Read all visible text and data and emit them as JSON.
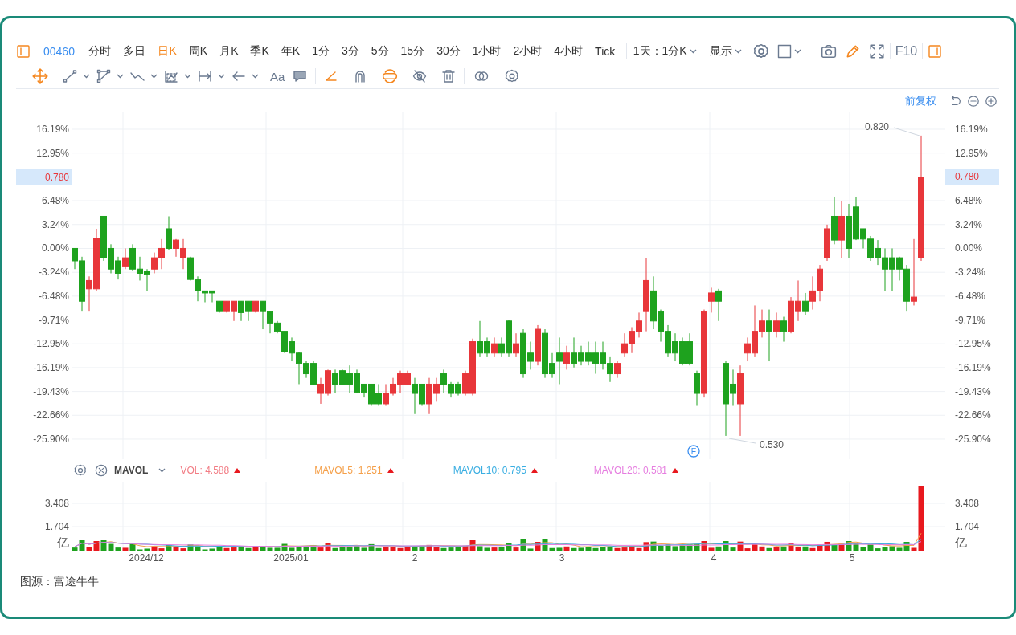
{
  "toolbar": {
    "symbol": "00460",
    "periods": [
      {
        "label": "分时",
        "selected": false
      },
      {
        "label": "多日",
        "selected": false
      },
      {
        "label": "日K",
        "selected": true
      },
      {
        "label": "周K",
        "selected": false
      },
      {
        "label": "月K",
        "selected": false
      },
      {
        "label": "季K",
        "selected": false
      },
      {
        "label": "年K",
        "selected": false
      },
      {
        "label": "1分",
        "selected": false
      },
      {
        "label": "3分",
        "selected": false
      },
      {
        "label": "5分",
        "selected": false
      },
      {
        "label": "15分",
        "selected": false
      },
      {
        "label": "30分",
        "selected": false
      },
      {
        "label": "1小时",
        "selected": false
      },
      {
        "label": "2小时",
        "selected": false
      },
      {
        "label": "4小时",
        "selected": false
      },
      {
        "label": "Tick",
        "selected": false
      }
    ],
    "range": "1天：1分K",
    "display": "显示",
    "f10": "F10"
  },
  "drawing_tools": {
    "text_tool": "Aa"
  },
  "chart": {
    "adjustment": "前复权",
    "current_price": "0.780",
    "right_axis": [
      {
        "text": "16.19%",
        "highlighted": false
      },
      {
        "text": "12.95%",
        "highlighted": false
      },
      {
        "text": "0.780",
        "highlighted": true
      },
      {
        "text": "6.48%",
        "highlighted": false
      },
      {
        "text": "3.24%",
        "highlighted": false
      },
      {
        "text": "0.00%",
        "highlighted": false
      },
      {
        "text": "-3.24%",
        "highlighted": false
      },
      {
        "text": "-6.48%",
        "highlighted": false
      },
      {
        "text": "-9.71%",
        "highlighted": false
      },
      {
        "text": "-12.95%",
        "highlighted": false
      },
      {
        "text": "-16.19%",
        "highlighted": false
      },
      {
        "text": "-19.43%",
        "highlighted": false
      },
      {
        "text": "-22.66%",
        "highlighted": false
      },
      {
        "text": "-25.90%",
        "highlighted": false
      }
    ],
    "high_label": "0.820",
    "low_label": "0.530",
    "event_marker": "E",
    "chart_data": {
      "type": "candlestick",
      "ylim": [
        -28.63,
        18.48
      ],
      "grid": true,
      "ref_lines": [
        {
          "axis": "y",
          "value": 9.7
        }
      ],
      "yticks": [
        {
          "value": 16.19,
          "label": "16.19%"
        },
        {
          "value": 12.95,
          "label": "12.95%"
        },
        {
          "value": 6.48,
          "label": "6.48%"
        },
        {
          "value": 3.24,
          "label": "3.24%"
        },
        {
          "value": 0,
          "label": "0.00%"
        },
        {
          "value": -3.24,
          "label": "-3.24%"
        },
        {
          "value": -6.48,
          "label": "-6.48%"
        },
        {
          "value": -9.71,
          "label": "-9.71%"
        },
        {
          "value": -12.95,
          "label": "-12.95%"
        },
        {
          "value": -16.19,
          "label": "-16.19%"
        },
        {
          "value": -19.43,
          "label": "-19.43%"
        },
        {
          "value": -22.66,
          "label": "-22.66%"
        },
        {
          "value": -25.9,
          "label": "-25.90%"
        }
      ],
      "categories": [
        null,
        null,
        null,
        null,
        null,
        null,
        null,
        null,
        null,
        null,
        null,
        null,
        null,
        null,
        null,
        null,
        null,
        null,
        null,
        null,
        null,
        null,
        null,
        null,
        null,
        null,
        null,
        null,
        null,
        null,
        null,
        null,
        null,
        null,
        null,
        null,
        null,
        null,
        null,
        null,
        null,
        null,
        null,
        null,
        null,
        null,
        null,
        null,
        null,
        null,
        null,
        null,
        null,
        null,
        null,
        null,
        null,
        null,
        null,
        null,
        null,
        null,
        null,
        null,
        null,
        null,
        null,
        null,
        null,
        null,
        null,
        null,
        null,
        null,
        null,
        null,
        null,
        null,
        null,
        null,
        null,
        null,
        null,
        null,
        null,
        null,
        null,
        null,
        null,
        null,
        null,
        null,
        null,
        null,
        null,
        null,
        null,
        null,
        null,
        null,
        null,
        null,
        null,
        null,
        null,
        null,
        null,
        null,
        null,
        null,
        null,
        null,
        null,
        null,
        null,
        null,
        null,
        null
      ],
      "ohlc": [
        [
          0,
          0,
          -2.81,
          -1.69
        ],
        [
          -1.69,
          -1.13,
          -8.58,
          -7.17
        ],
        [
          -5.49,
          -3.8,
          -8.58,
          -4.36
        ],
        [
          -5.49,
          2.67,
          -5.77,
          1.41
        ],
        [
          4.36,
          4.36,
          -1.69,
          -1.27
        ],
        [
          0,
          0.56,
          -3.38,
          -2.81
        ],
        [
          -1.69,
          -1.13,
          -4.22,
          -3.38
        ],
        [
          -2.39,
          0,
          -2.81,
          -1.27
        ],
        [
          0,
          0.56,
          -3.09,
          -2.81
        ],
        [
          -2.81,
          -1.13,
          -4.36,
          -3.38
        ],
        [
          -3.09,
          -2.81,
          -5.77,
          -3.52
        ],
        [
          -2.81,
          -0.56,
          -3.38,
          -1.27
        ],
        [
          -1.27,
          1.27,
          -2.81,
          0
        ],
        [
          2.67,
          4.36,
          -0.28,
          0
        ],
        [
          0,
          1.27,
          -1.13,
          1.13
        ],
        [
          -1.27,
          1.27,
          -2.81,
          0
        ],
        [
          -1.27,
          -1.13,
          -4.36,
          -4.22
        ],
        [
          -4.22,
          -3.8,
          -7.17,
          -5.77
        ],
        [
          -5.77,
          -5.77,
          -7.31,
          -6.05
        ],
        [
          -5.77,
          -5.77,
          -7.31,
          -6.05
        ],
        [
          -7.17,
          -7.17,
          -8.72,
          -8.58
        ],
        [
          -8.58,
          -7.17,
          -8.72,
          -7.17
        ],
        [
          -8.58,
          -7.17,
          -9.85,
          -7.17
        ],
        [
          -7.17,
          -7.17,
          -9.85,
          -8.72
        ],
        [
          -7.17,
          -7.17,
          -9.85,
          -8.58
        ],
        [
          -8.58,
          -7.17,
          -8.72,
          -7.17
        ],
        [
          -7.17,
          -7.17,
          -10.97,
          -8.58
        ],
        [
          -8.58,
          -8.58,
          -11.53,
          -10.13
        ],
        [
          -10.13,
          -9.85,
          -11.53,
          -11.25
        ],
        [
          -11.25,
          -11.25,
          -14.21,
          -14.07
        ],
        [
          -12.66,
          -12.1,
          -15.33,
          -14.21
        ],
        [
          -14.21,
          -14.07,
          -18.43,
          -15.61
        ],
        [
          -15.61,
          -15.33,
          -17.58,
          -17.02
        ],
        [
          -15.61,
          -15.33,
          -18.57,
          -18.43
        ],
        [
          -19.69,
          -17.58,
          -21.1,
          -18.43
        ],
        [
          -19.69,
          -16.46,
          -19.97,
          -16.6
        ],
        [
          -17.02,
          -16.46,
          -19.69,
          -18.43
        ],
        [
          -16.6,
          -16.46,
          -18.57,
          -18.43
        ],
        [
          -17.02,
          -15.89,
          -19.69,
          -18.43
        ],
        [
          -17.02,
          -16.46,
          -19.69,
          -19.55
        ],
        [
          -18.43,
          -18.43,
          -20.25,
          -19.55
        ],
        [
          -18.43,
          -18.43,
          -21.38,
          -21.1
        ],
        [
          -19.69,
          -18.43,
          -21.38,
          -21.1
        ],
        [
          -21.1,
          -18.43,
          -21.38,
          -19.69
        ],
        [
          -19.69,
          -17.58,
          -19.97,
          -18.43
        ],
        [
          -18.43,
          -16.6,
          -19.69,
          -17.02
        ],
        [
          -18.43,
          -16.6,
          -18.57,
          -17.02
        ],
        [
          -18.43,
          -17.58,
          -22.5,
          -19.69
        ],
        [
          -18.43,
          -18.43,
          -21.38,
          -21.1
        ],
        [
          -21.1,
          -17.58,
          -22.5,
          -18.43
        ],
        [
          -19.69,
          -17.58,
          -20.82,
          -18.43
        ],
        [
          -17.02,
          -16.46,
          -19.69,
          -18.43
        ],
        [
          -18.43,
          -18.14,
          -20.25,
          -19.69
        ],
        [
          -18.43,
          -18.14,
          -19.97,
          -19.69
        ],
        [
          -19.69,
          -16.6,
          -19.97,
          -17.02
        ],
        [
          -19.69,
          -12.24,
          -19.97,
          -12.66
        ],
        [
          -12.66,
          -9.85,
          -14.77,
          -14.21
        ],
        [
          -12.66,
          -12.1,
          -14.77,
          -14.21
        ],
        [
          -14.21,
          -12.1,
          -14.77,
          -12.94
        ],
        [
          -12.94,
          -12.1,
          -14.77,
          -14.21
        ],
        [
          -9.85,
          -9.7,
          -14.77,
          -14.21
        ],
        [
          -14.21,
          -11.53,
          -14.77,
          -12.94
        ],
        [
          -11.53,
          -10.97,
          -17.58,
          -17.02
        ],
        [
          -14.21,
          -12.66,
          -16.46,
          -15.33
        ],
        [
          -15.33,
          -10.41,
          -15.89,
          -10.97
        ],
        [
          -11.53,
          -10.97,
          -17.58,
          -17.02
        ],
        [
          -15.61,
          -14.21,
          -17.58,
          -17.02
        ],
        [
          -14.21,
          -12.1,
          -18.43,
          -15.33
        ],
        [
          -15.61,
          -13.22,
          -16.46,
          -14.21
        ],
        [
          -14.21,
          -12.1,
          -16.17,
          -15.61
        ],
        [
          -14.21,
          -13.22,
          -15.89,
          -15.33
        ],
        [
          -14.21,
          -12.66,
          -15.89,
          -15.33
        ],
        [
          -14.21,
          -12.66,
          -17.02,
          -15.61
        ],
        [
          -14.21,
          -12.66,
          -16.46,
          -15.61
        ],
        [
          -15.61,
          -14.77,
          -18.14,
          -17.02
        ],
        [
          -17.02,
          -15.33,
          -17.58,
          -15.61
        ],
        [
          -14.21,
          -11.53,
          -14.77,
          -12.94
        ],
        [
          -12.94,
          -10.69,
          -14.21,
          -11.25
        ],
        [
          -11.25,
          -8.72,
          -12.1,
          -9.85
        ],
        [
          -8.58,
          -1.27,
          -11.25,
          -4.36
        ],
        [
          -5.77,
          -3.8,
          -10.97,
          -9.85
        ],
        [
          -8.58,
          -8.3,
          -12.66,
          -11.25
        ],
        [
          -11.25,
          -10.41,
          -14.77,
          -14.21
        ],
        [
          -12.66,
          -11.53,
          -15.33,
          -14.21
        ],
        [
          -12.66,
          -12.1,
          -15.89,
          -15.61
        ],
        [
          -12.66,
          -11.53,
          -15.89,
          -15.61
        ],
        [
          -17.02,
          -16.6,
          -21.38,
          -19.69
        ],
        [
          -19.69,
          -8.3,
          -20.25,
          -8.58
        ],
        [
          -7.17,
          -5.34,
          -8.72,
          -6.05
        ],
        [
          -5.77,
          -5.49,
          -9.85,
          -7.17
        ],
        [
          -15.61,
          -15.33,
          -25.46,
          -21.1
        ],
        [
          -18.43,
          -16.46,
          -21.38,
          -19.69
        ],
        [
          -21.1,
          -15.89,
          -25.46,
          -17.02
        ],
        [
          -14.21,
          -12.1,
          -15.33,
          -12.94
        ],
        [
          -14.21,
          -7.74,
          -14.77,
          -11.25
        ],
        [
          -11.25,
          -8.3,
          -12.1,
          -9.85
        ],
        [
          -9.85,
          -8.3,
          -15.33,
          -11.25
        ],
        [
          -11.25,
          -8.72,
          -12.1,
          -9.85
        ],
        [
          -9.85,
          -9.28,
          -12.66,
          -11.25
        ],
        [
          -11.25,
          -6.61,
          -11.53,
          -7.17
        ],
        [
          -8.58,
          -4.36,
          -9.85,
          -7.17
        ],
        [
          -7.17,
          -6.05,
          -9,
          -8.58
        ],
        [
          -7.17,
          -3.8,
          -8.3,
          -5.77
        ],
        [
          -5.77,
          -2.25,
          -7.17,
          -2.81
        ],
        [
          -1.27,
          3.23,
          -1.69,
          2.67
        ],
        [
          4.36,
          7.03,
          0.56,
          1.13
        ],
        [
          1.13,
          6.47,
          -1.27,
          4.36
        ],
        [
          4.36,
          6.05,
          -1.27,
          0
        ],
        [
          5.63,
          7.03,
          1.13,
          1.27
        ],
        [
          2.67,
          2.67,
          0,
          1.27
        ],
        [
          1.27,
          1.69,
          -1.69,
          -1.27
        ],
        [
          0,
          1.13,
          -2.25,
          -1.27
        ],
        [
          -1.27,
          0,
          -5.77,
          -2.81
        ],
        [
          -1.27,
          0,
          -5.77,
          -2.81
        ],
        [
          -1.27,
          -1.13,
          -4.36,
          -2.81
        ],
        [
          -2.81,
          -2.25,
          -8.58,
          -7.17
        ],
        [
          -7.17,
          1.27,
          -7.74,
          -6.61
        ],
        [
          -1.27,
          15.33,
          -1.69,
          9.7
        ]
      ]
    }
  },
  "volume": {
    "indicator": "MAVOL",
    "legend": [
      {
        "text": "VOL: 4.588",
        "color": "#f27c84"
      },
      {
        "text": "MAVOL5: 1.251",
        "color": "#f5a04a"
      },
      {
        "text": "MAVOL10: 0.795",
        "color": "#3aaee2"
      },
      {
        "text": "MAVOL20: 0.581",
        "color": "#e67ee0"
      }
    ],
    "left_axis": [
      "3.408",
      "1.704",
      "亿"
    ],
    "right_axis": [
      "3.408",
      "1.704",
      "亿"
    ],
    "dates": [
      "2024/12",
      "2025/01",
      "2",
      "3",
      "4",
      "5"
    ]
  },
  "caption": "图源：富途牛牛"
}
